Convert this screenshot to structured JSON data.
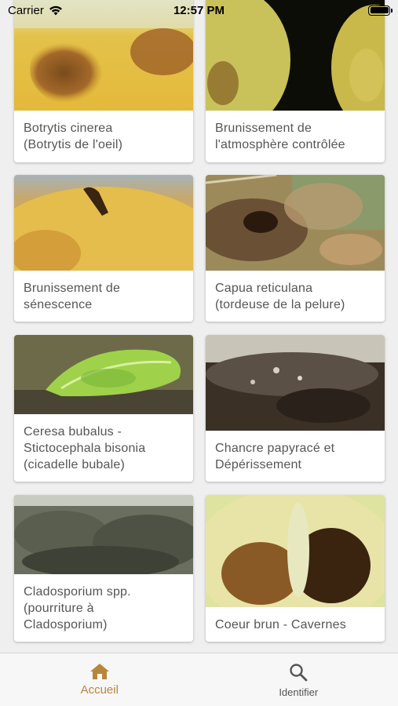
{
  "status": {
    "carrier": "Carrier",
    "time": "12:57 PM"
  },
  "cards": [
    {
      "title": "Botrytis cinerea\n(Botrytis de l'oeil)"
    },
    {
      "title": "Brunissement de\nl'atmosphère contrôlée"
    },
    {
      "title": "Brunissement de\nsénescence"
    },
    {
      "title": "Capua reticulana\n(tordeuse de la pelure)"
    },
    {
      "title": "Ceresa bubalus -\nStictocephala bisonia\n(cicadelle bubale)"
    },
    {
      "title": "Chancre papyracé et\nDépérissement"
    },
    {
      "title": "Cladosporium spp.\n(pourriture à\nCladosporium)"
    },
    {
      "title": "Coeur brun - Cavernes"
    }
  ],
  "tabs": {
    "home": {
      "label": "Accueil",
      "icon": "home-icon",
      "color": "#b8863b"
    },
    "identify": {
      "label": "Identifier",
      "icon": "search-icon",
      "color": "#555555"
    }
  },
  "colors": {
    "accent": "#b8863b",
    "background": "#efefef"
  }
}
